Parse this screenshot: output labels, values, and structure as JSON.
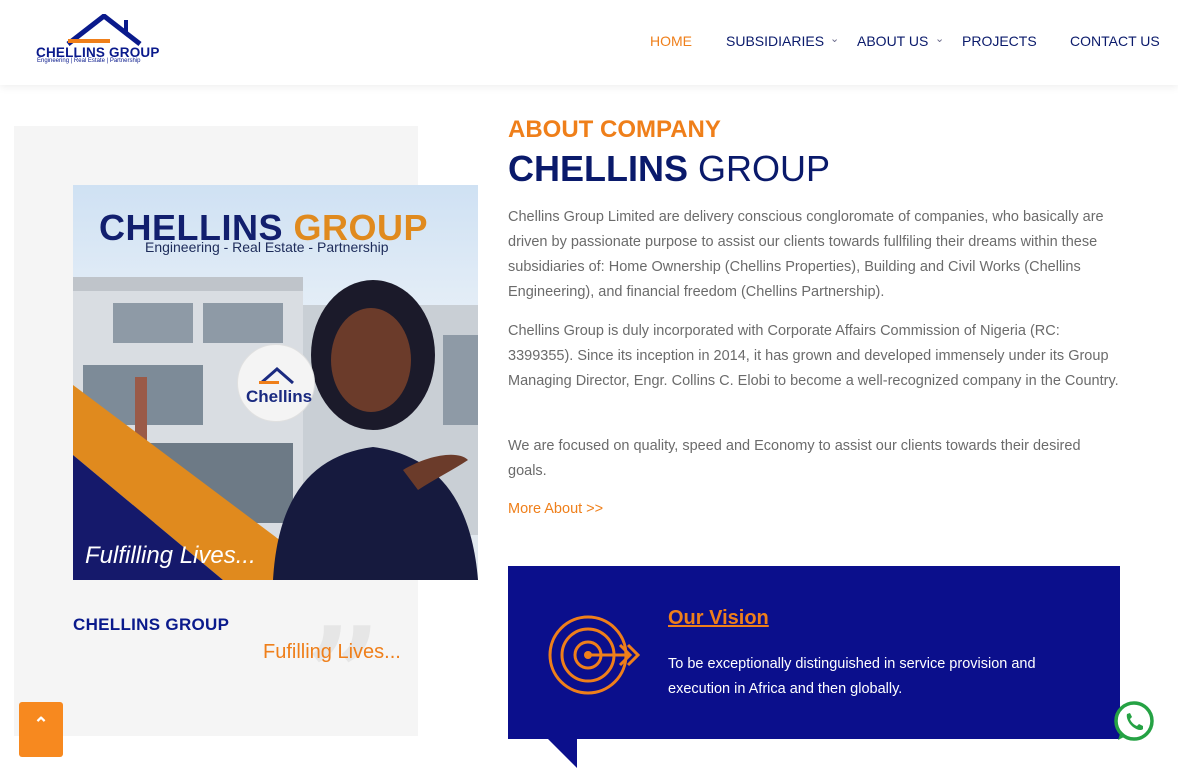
{
  "header": {
    "logo_name": "CHELLINS GROUP",
    "logo_tagline": "Engineering | Real Estate | Partnership",
    "nav": [
      {
        "label": "HOME",
        "active": true
      },
      {
        "label": "SUBSIDIARIES",
        "has_dropdown": true
      },
      {
        "label": "ABOUT US",
        "has_dropdown": true
      },
      {
        "label": "PROJECTS"
      },
      {
        "label": "CONTACT US"
      }
    ]
  },
  "promo": {
    "title_first": "CHELLINS",
    "title_second": "GROUP",
    "subtitle": "Engineering - Real Estate - Partnership",
    "circle_label": "Chellins",
    "footer": "Fulfilling Lives..."
  },
  "left_card": {
    "name": "CHELLINS GROUP",
    "tagline": "Fufilling Lives..."
  },
  "about": {
    "kicker": "ABOUT COMPANY",
    "heading_bold": "CHELLINS",
    "heading_rest": "GROUP",
    "paragraphs": [
      "Chellins Group Limited are delivery conscious congloromate of companies, who basically are driven by passionate purpose to assist our clients towards fullfiling their dreams within these subsidiaries of: Home Ownership (Chellins Properties), Building and Civil Works (Chellins Engineering), and financial freedom (Chellins Partnership).",
      "Chellins Group is duly incorporated with Corporate Affairs Commission of Nigeria (RC: 3399355). Since its inception in 2014, it has grown and developed immensely under its Group Managing Director, Engr. Collins C. Elobi to become a well-recognized company in the Country.",
      "We are focused on quality, speed and Economy to assist our clients towards their desired goals."
    ],
    "more_link": "More About >>"
  },
  "vision": {
    "title": "Our Vision",
    "text": "To be exceptionally distinguished in service provision and execution in Africa and then globally.",
    "icon": "target-icon"
  },
  "floating": {
    "to_top_icon": "chevron-up-icon",
    "whatsapp_icon": "whatsapp-icon"
  },
  "colors": {
    "brand_navy": "#0a1a8c",
    "brand_orange": "#ef7f1a",
    "vision_bg": "#0b0f8c"
  }
}
